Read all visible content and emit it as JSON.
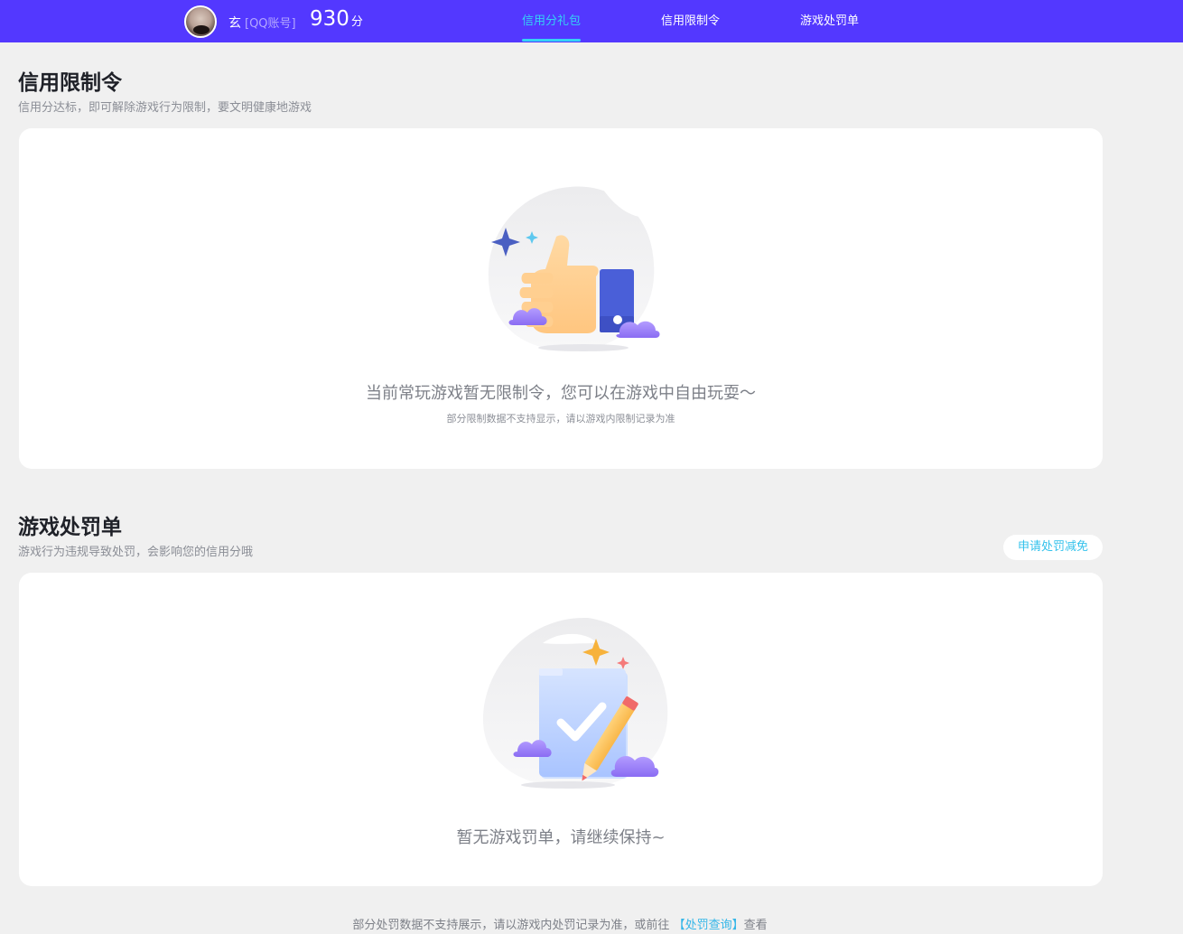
{
  "header": {
    "user_name": "玄",
    "account_type": "[QQ账号]",
    "score": "930",
    "score_unit": "分",
    "tabs": [
      {
        "label": "信用分礼包",
        "active": true
      },
      {
        "label": "信用限制令",
        "active": false
      },
      {
        "label": "游戏处罚单",
        "active": false
      }
    ],
    "bar_color": "#5338ff",
    "accent_color": "#34d2f5"
  },
  "restriction": {
    "title": "信用限制令",
    "description": "信用分达标，即可解除游戏行为限制，要文明健康地游戏",
    "empty_text": "当前常玩游戏暂无限制令，您可以在游戏中自由玩耍～",
    "empty_note": "部分限制数据不支持显示，请以游戏内限制记录为准",
    "illustration_icon": "thumbs-up-icon"
  },
  "penalty": {
    "title": "游戏处罚单",
    "description": "游戏行为违规导致处罚，会影响您的信用分哦",
    "appeal_button": "申请处罚减免",
    "empty_text": "暂无游戏罚单，请继续保持~",
    "illustration_icon": "clipboard-check-icon"
  },
  "footer": {
    "prefix": "部分处罚数据不支持展示，请以游戏内处罚记录为准，或前往",
    "link": "【处罚查询】",
    "suffix": "查看"
  }
}
